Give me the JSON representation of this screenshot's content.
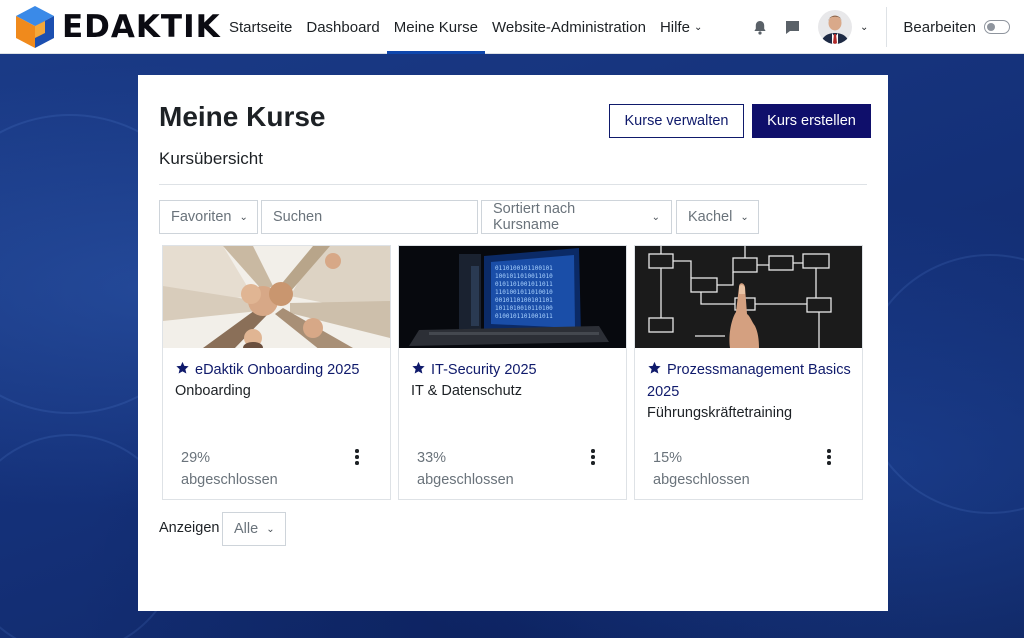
{
  "brand": {
    "name": "EDAKTIK",
    "accent": "#0f47ad"
  },
  "nav": {
    "items": [
      {
        "label": "Startseite",
        "active": false
      },
      {
        "label": "Dashboard",
        "active": false
      },
      {
        "label": "Meine Kurse",
        "active": true
      },
      {
        "label": "Website-Administration",
        "active": false
      },
      {
        "label": "Hilfe",
        "active": false,
        "has_dropdown": true
      }
    ],
    "icons": [
      "bell-icon",
      "chat-icon"
    ],
    "edit_mode_label": "Bearbeiten",
    "edit_mode_on": false
  },
  "page": {
    "title": "Meine Kurse",
    "manage_button": "Kurse verwalten",
    "create_button": "Kurs erstellen",
    "section_title": "Kursübersicht"
  },
  "filters": {
    "grouping": "Favoriten",
    "search_placeholder": "Suchen",
    "sort": "Sortiert nach Kursname",
    "view": "Kachel"
  },
  "courses": [
    {
      "name": "eDaktik Onboarding 2025",
      "category": "Onboarding",
      "progress": "29%",
      "progress_label": "abgeschlossen",
      "favourite": true,
      "image": "team-hands"
    },
    {
      "name": "IT-Security 2025",
      "category": "IT & Datenschutz",
      "progress": "33%",
      "progress_label": "abgeschlossen",
      "favourite": true,
      "image": "binary-screen"
    },
    {
      "name": "Prozessmanagement Basics 2025",
      "category": "Führungskräftetraining",
      "progress": "15%",
      "progress_label": "abgeschlossen",
      "favourite": true,
      "image": "flowchart"
    }
  ],
  "footer": {
    "show_label": "Anzeigen",
    "show_value": "Alle"
  }
}
